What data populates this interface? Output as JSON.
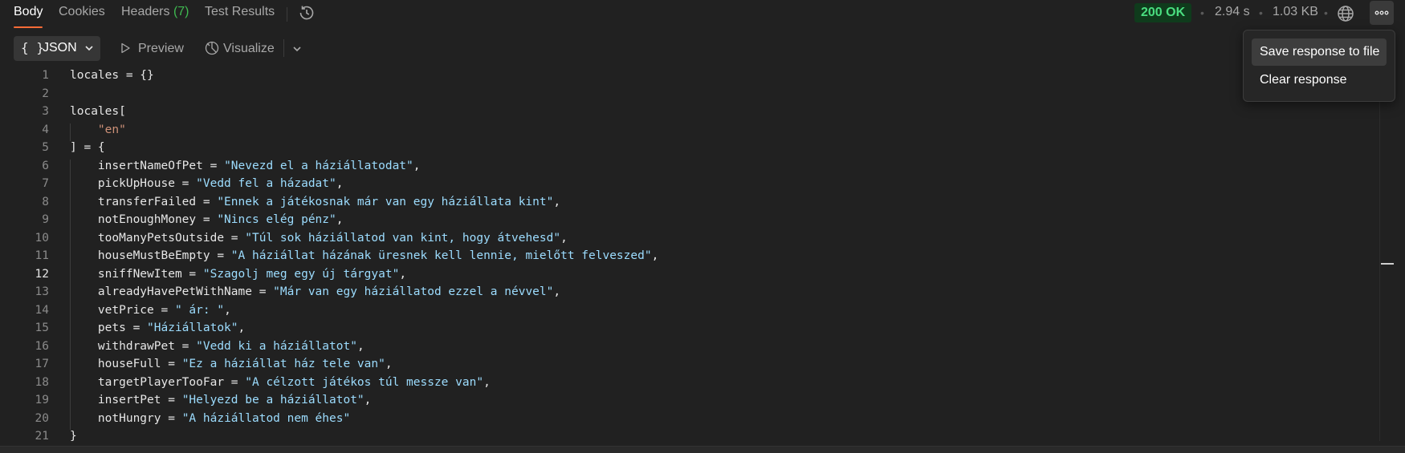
{
  "tabs": [
    {
      "label": "Body"
    },
    {
      "label": "Cookies"
    },
    {
      "label": "Headers",
      "count": "(7)"
    },
    {
      "label": "Test Results"
    }
  ],
  "response_meta": {
    "status": "200 OK",
    "time": "2.94 s",
    "size": "1.03 KB"
  },
  "toolbar": {
    "format_braces": "{ }",
    "format_label": "JSON",
    "preview_label": "Preview",
    "visualize_label": "Visualize"
  },
  "menu": {
    "items": [
      {
        "label": "Save response to file"
      },
      {
        "label": "Clear response"
      }
    ]
  },
  "editor": {
    "current_line": 12,
    "lines": [
      {
        "n": "1",
        "code": "locales = {}"
      },
      {
        "n": "2",
        "code": ""
      },
      {
        "n": "3",
        "code": "locales["
      },
      {
        "n": "4",
        "code": "    \"en\""
      },
      {
        "n": "5",
        "code": "] = {"
      },
      {
        "n": "6",
        "key": "    insertNameOfPet = ",
        "value": "\"Nevezd el a háziállatodat\"",
        "tail": ","
      },
      {
        "n": "7",
        "key": "    pickUpHouse = ",
        "value": "\"Vedd fel a házadat\"",
        "tail": ","
      },
      {
        "n": "8",
        "key": "    transferFailed = ",
        "value": "\"Ennek a játékosnak már van egy háziállata kint\"",
        "tail": ","
      },
      {
        "n": "9",
        "key": "    notEnoughMoney = ",
        "value": "\"Nincs elég pénz\"",
        "tail": ","
      },
      {
        "n": "10",
        "key": "    tooManyPetsOutside = ",
        "value": "\"Túl sok háziállatod van kint, hogy átvehesd\"",
        "tail": ","
      },
      {
        "n": "11",
        "key": "    houseMustBeEmpty = ",
        "value": "\"A háziállat házának üresnek kell lennie, mielőtt felveszed\"",
        "tail": ","
      },
      {
        "n": "12",
        "key": "    sniffNewItem = ",
        "value": "\"Szagolj meg egy új tárgyat\"",
        "tail": ","
      },
      {
        "n": "13",
        "key": "    alreadyHavePetWithName = ",
        "value": "\"Már van egy háziállatod ezzel a névvel\"",
        "tail": ","
      },
      {
        "n": "14",
        "key": "    vetPrice = ",
        "value": "\" ár: \"",
        "tail": ","
      },
      {
        "n": "15",
        "key": "    pets = ",
        "value": "\"Háziállatok\"",
        "tail": ","
      },
      {
        "n": "16",
        "key": "    withdrawPet = ",
        "value": "\"Vedd ki a háziállatot\"",
        "tail": ","
      },
      {
        "n": "17",
        "key": "    houseFull = ",
        "value": "\"Ez a háziállat ház tele van\"",
        "tail": ","
      },
      {
        "n": "18",
        "key": "    targetPlayerTooFar = ",
        "value": "\"A célzott játékos túl messze van\"",
        "tail": ","
      },
      {
        "n": "19",
        "key": "    insertPet = ",
        "value": "\"Helyezd be a háziállatot\"",
        "tail": ","
      },
      {
        "n": "20",
        "key": "    notHungry = ",
        "value": "\"A háziállatod nem éhes\"",
        "tail": ""
      },
      {
        "n": "21",
        "code": "}"
      }
    ]
  }
}
